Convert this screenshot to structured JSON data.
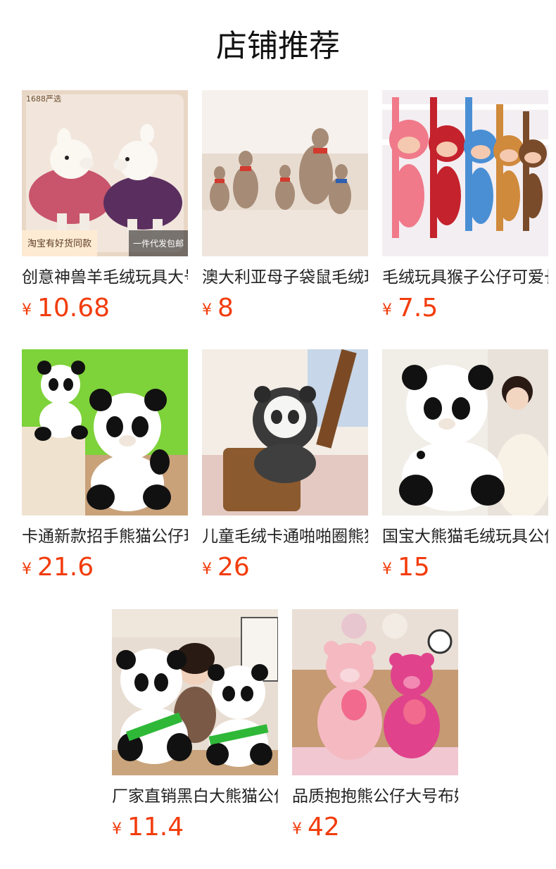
{
  "header": {
    "title": "店铺推荐"
  },
  "products": [
    {
      "name": "创意神兽羊毛绒玩具大号公仔",
      "price": "10.68",
      "currency": "¥",
      "badges": {
        "top_left": "1688严选",
        "bottom_left": "淘宝有好货同款",
        "bottom_right": "一件代发包邮"
      }
    },
    {
      "name": "澳大利亚母子袋鼠毛绒玩具",
      "price": "8",
      "currency": "¥"
    },
    {
      "name": "毛绒玩具猴子公仔可爱长臂猴",
      "price": "7.5",
      "currency": "¥"
    },
    {
      "name": "卡通新款招手熊猫公仔玩具",
      "price": "21.6",
      "currency": "¥"
    },
    {
      "name": "儿童毛绒卡通啪啪圈熊猫",
      "price": "26",
      "currency": "¥"
    },
    {
      "name": "国宝大熊猫毛绒玩具公仔",
      "price": "15",
      "currency": "¥"
    },
    {
      "name": "厂家直销黑白大熊猫公仔",
      "price": "11.4",
      "currency": "¥"
    },
    {
      "name": "品质抱抱熊公仔大号布娃娃",
      "price": "42",
      "currency": "¥"
    }
  ]
}
